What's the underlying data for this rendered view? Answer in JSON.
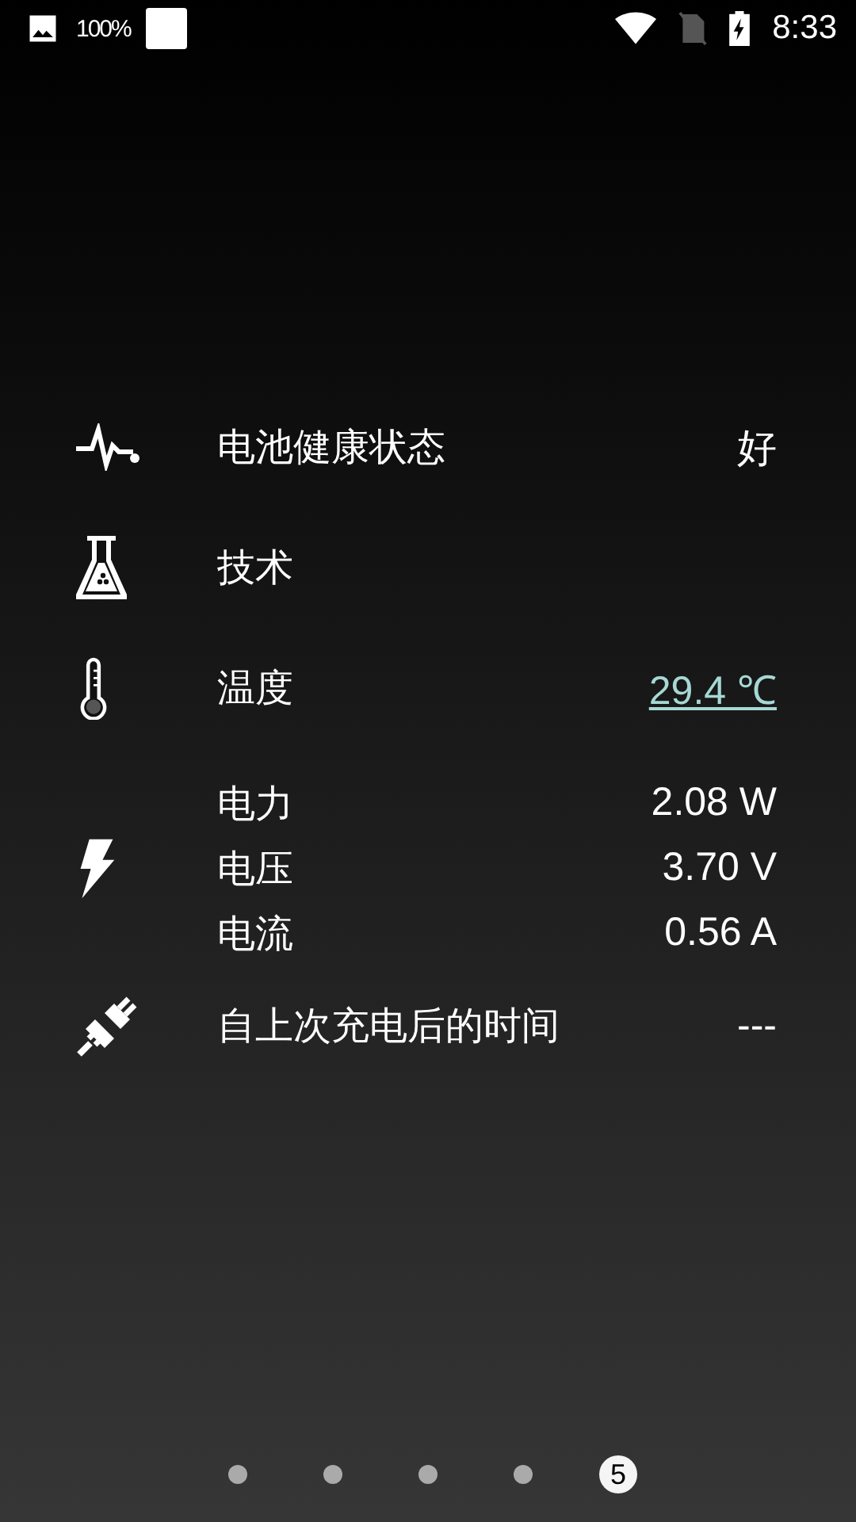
{
  "status_bar": {
    "battery_percent": "100%",
    "time": "8:33"
  },
  "rows": [
    {
      "kind": "pulse",
      "label": "电池健康状态",
      "value": "好",
      "link": false
    },
    {
      "kind": "flask",
      "label": "技术"
    },
    {
      "kind": "thermometer",
      "label": "温度",
      "value": "29.4 ℃",
      "link": true
    },
    {
      "kind": "bolt",
      "lines": [
        {
          "label": "电力",
          "value": "2.08 W"
        },
        {
          "label": "电压",
          "value": "3.70 V"
        },
        {
          "label": "电流",
          "value": "0.56 A"
        }
      ]
    },
    {
      "kind": "plug",
      "label": "自上次充电后的时间",
      "value": "---",
      "link": false
    }
  ],
  "pages": [
    {
      "selected": false
    },
    {
      "selected": false
    },
    {
      "selected": false
    },
    {
      "selected": false
    },
    {
      "selected": true,
      "label": "5"
    }
  ]
}
